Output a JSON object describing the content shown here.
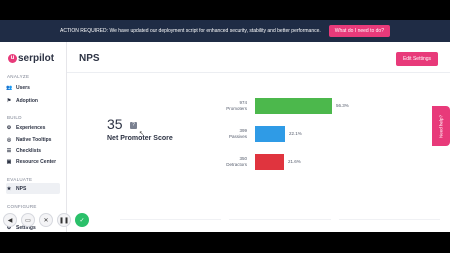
{
  "banner": {
    "text": "ACTION REQUIRED: We have updated our deployment script for enhanced security, stability and better performance.",
    "button": "What do I need to do?"
  },
  "logo": {
    "mark": "u",
    "text": "serpilot"
  },
  "sidebar": {
    "sections": [
      "ANALYZE",
      "BUILD",
      "EVALUATE",
      "CONFIGURE"
    ],
    "items": [
      {
        "label": "Users",
        "icon": "users-icon",
        "glyph": "👥"
      },
      {
        "label": "Adoption",
        "icon": "flag-icon",
        "glyph": "⚑"
      },
      {
        "label": "Experiences",
        "icon": "gear-icon",
        "glyph": "⚙"
      },
      {
        "label": "Native Tooltips",
        "icon": "tooltip-icon",
        "glyph": "◎"
      },
      {
        "label": "Checklists",
        "icon": "checklist-icon",
        "glyph": "☰"
      },
      {
        "label": "Resource Center",
        "icon": "resource-icon",
        "glyph": "▣"
      },
      {
        "label": "NPS",
        "icon": "star-icon",
        "glyph": "★"
      },
      {
        "label": "Settings",
        "icon": "settings-icon",
        "glyph": "⚙"
      }
    ]
  },
  "page": {
    "title": "NPS",
    "edit_button": "Edit Settings"
  },
  "score": {
    "value": "35",
    "info": "?",
    "label": "Net Promoter Score"
  },
  "rows": [
    {
      "count": "974",
      "label": "Promoters",
      "percent": 56.3,
      "pct_label": "56.3%",
      "color": "#4cb84c"
    },
    {
      "count": "399",
      "label": "Passives",
      "percent": 22.1,
      "pct_label": "22.1%",
      "color": "#2f9be6"
    },
    {
      "count": "350",
      "label": "Detractors",
      "percent": 21.6,
      "pct_label": "21.6%",
      "color": "#e0343e"
    }
  ],
  "feedback": {
    "label": "Need help?"
  },
  "toolbar": [
    {
      "name": "back-icon",
      "glyph": "◀"
    },
    {
      "name": "screen-icon",
      "glyph": "▭"
    },
    {
      "name": "close-icon",
      "glyph": "✕"
    },
    {
      "name": "pause-icon",
      "glyph": "❚❚"
    },
    {
      "name": "check-icon",
      "glyph": "✓"
    }
  ],
  "colors": {
    "accent": "#e83a7a",
    "banner": "#1f2c45"
  }
}
